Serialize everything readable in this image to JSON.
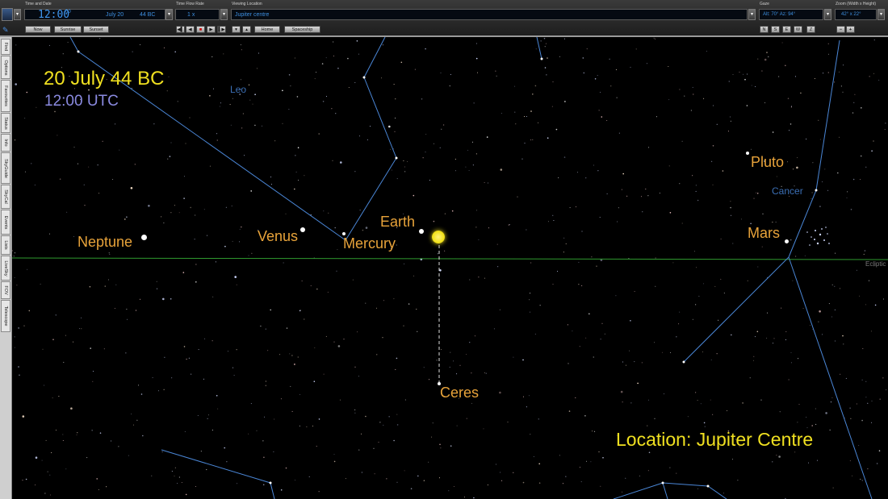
{
  "toolbar": {
    "time_date": {
      "label": "Time and Date",
      "time": "12:00",
      "seconds": "00",
      "date": "July 20",
      "year": "44 BC",
      "buttons": [
        "Now",
        "Sunrise",
        "Sunset"
      ]
    },
    "time_flow": {
      "label": "Time Flow Rate",
      "value": "1 x"
    },
    "viewing_location": {
      "label": "Viewing Location",
      "value": "Jupiter centre",
      "home": "Home",
      "spaceship": "Spaceship"
    },
    "gaze": {
      "label": "Gaze",
      "value": "Alt: 70°  Az: 94°",
      "buttons": [
        "N",
        "S",
        "E",
        "W",
        "Z"
      ]
    },
    "zoom": {
      "label": "Zoom (Width x Height)",
      "value": "42° x 22°"
    }
  },
  "sidebar": {
    "tabs": [
      "Find",
      "Options",
      "Favourites",
      "Status",
      "Info",
      "SkyGuide",
      "SkyCal",
      "Events",
      "Lists",
      "LiveSky",
      "FOV",
      "Telescope"
    ]
  },
  "sky": {
    "date_overlay": "20 July 44 BC",
    "time_overlay": "12:00 UTC",
    "location_overlay": "Location: Jupiter Centre",
    "ecliptic_label": "Ecliptic",
    "constellations": [
      "Leo",
      "Cancer"
    ],
    "planets": [
      "Neptune",
      "Venus",
      "Mercury",
      "Earth",
      "Ceres",
      "Pluto",
      "Mars"
    ]
  },
  "colors": {
    "background": "#000000",
    "planet_label": "#e8a33a",
    "overlay_yellow": "#f0e020",
    "overlay_time": "#8a8ae0",
    "constellation_line": "#4a86d6",
    "ecliptic": "#2f9a2f",
    "sun": "#f2e21c"
  }
}
